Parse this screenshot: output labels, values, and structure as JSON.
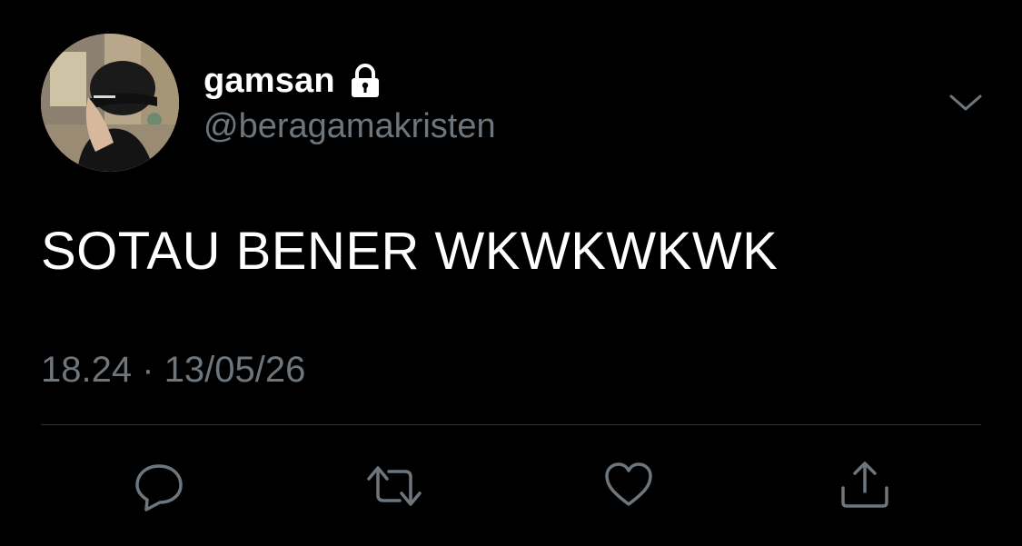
{
  "tweet": {
    "display_name": "gamsan",
    "handle": "@beragamakristen",
    "text": "SOTAU BENER WKWKWKWK",
    "time": "18.24",
    "separator": "·",
    "date": "13/05/26",
    "protected": true,
    "icons": {
      "lock": "lock-icon",
      "menu": "chevron-down-icon",
      "reply": "reply-icon",
      "retweet": "retweet-icon",
      "like": "heart-icon",
      "share": "share-icon"
    }
  },
  "colors": {
    "background": "#000000",
    "primary_text": "#ffffff",
    "secondary_text": "#6e767d",
    "divider": "#2f3336"
  }
}
